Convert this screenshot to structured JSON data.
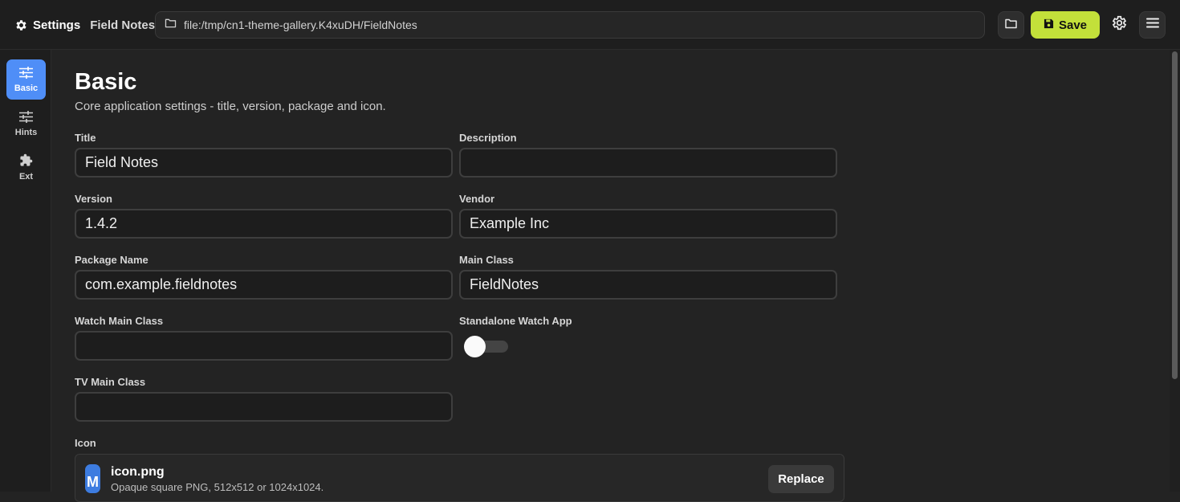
{
  "header": {
    "title": "Settings",
    "project_name": "Field Notes",
    "path": "file:/tmp/cn1-theme-gallery.K4xuDH/FieldNotes",
    "save_label": "Save"
  },
  "sidebar": {
    "items": [
      {
        "label": "Basic",
        "icon": "sliders-icon",
        "active": true
      },
      {
        "label": "Hints",
        "icon": "sliders-icon",
        "active": false
      },
      {
        "label": "Ext",
        "icon": "puzzle-icon",
        "active": false
      }
    ]
  },
  "page": {
    "title": "Basic",
    "subtitle": "Core application settings - title, version, package and icon."
  },
  "form": {
    "title": {
      "label": "Title",
      "value": "Field Notes"
    },
    "description": {
      "label": "Description",
      "value": ""
    },
    "version": {
      "label": "Version",
      "value": "1.4.2"
    },
    "vendor": {
      "label": "Vendor",
      "value": "Example Inc"
    },
    "package_name": {
      "label": "Package Name",
      "value": "com.example.fieldnotes"
    },
    "main_class": {
      "label": "Main Class",
      "value": "FieldNotes"
    },
    "watch_main_class": {
      "label": "Watch Main Class",
      "value": ""
    },
    "standalone_watch_app": {
      "label": "Standalone Watch App",
      "checked": false
    },
    "tv_main_class": {
      "label": "TV Main Class",
      "value": ""
    },
    "icon": {
      "label": "Icon",
      "thumb_letter": "M",
      "file_name": "icon.png",
      "hint": "Opaque square PNG, 512x512 or 1024x1024.",
      "replace_label": "Replace"
    }
  },
  "colors": {
    "accent": "#4f8ef7",
    "save": "#c3e03a",
    "background": "#232323"
  }
}
